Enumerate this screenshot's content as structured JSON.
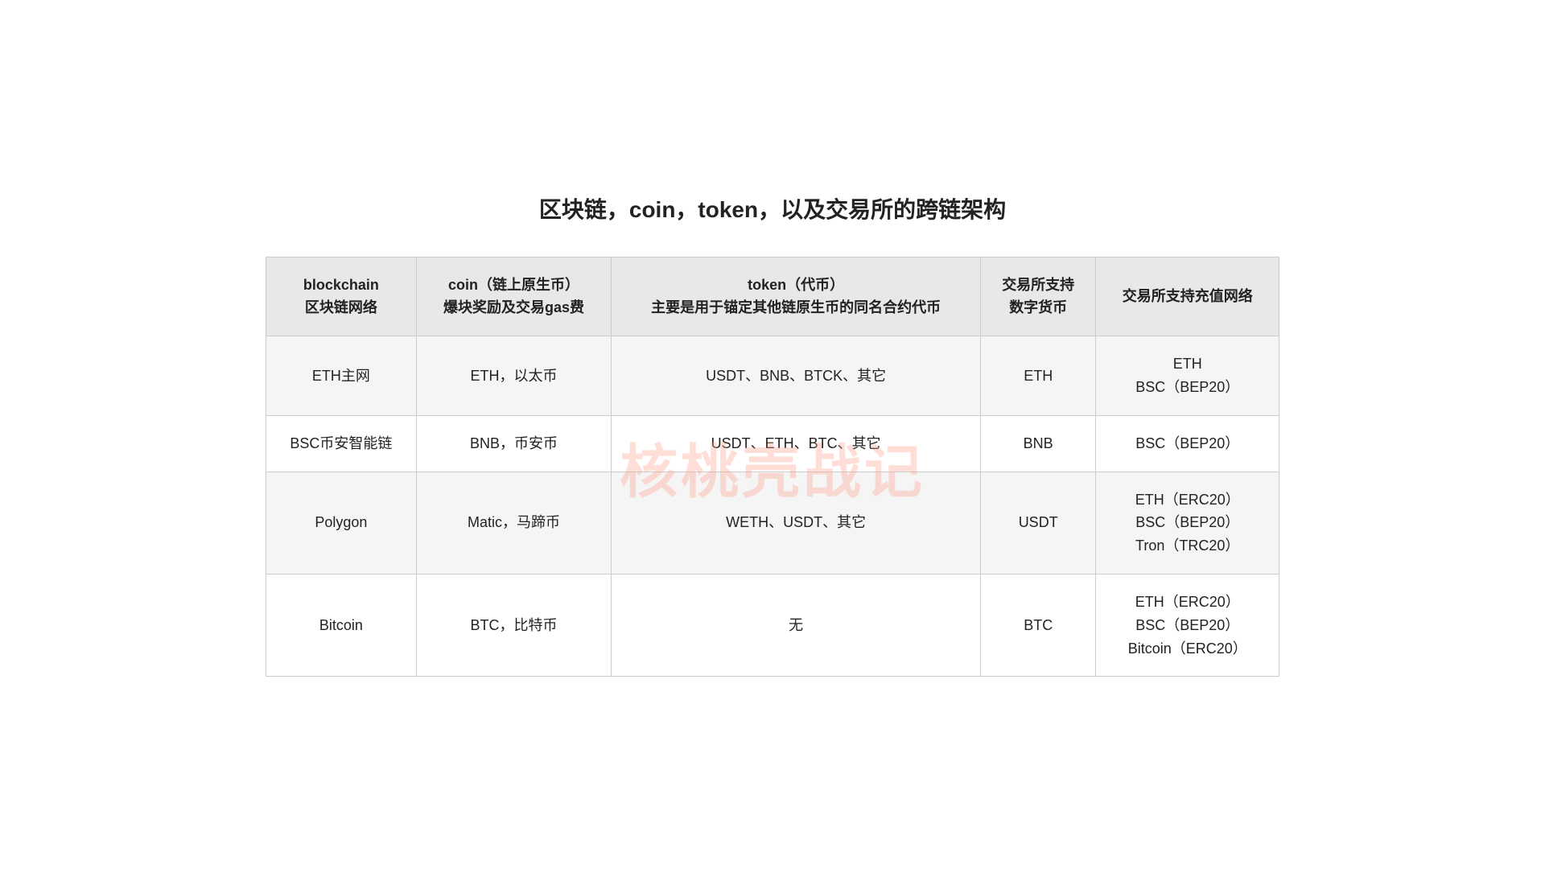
{
  "page": {
    "title": "区块链，coin，token，以及交易所的跨链架构"
  },
  "watermark": "核桃壳战记",
  "table": {
    "headers": [
      {
        "id": "col-blockchain",
        "line1": "blockchain",
        "line2": "区块链网络"
      },
      {
        "id": "col-coin",
        "line1": "coin（链上原生币）",
        "line2": "爆块奖励及交易gas费"
      },
      {
        "id": "col-token",
        "line1": "token（代币）",
        "line2": "主要是用于锚定其他链原生币的同名合约代币"
      },
      {
        "id": "col-exchange-coin",
        "line1": "交易所支持",
        "line2": "数字货币"
      },
      {
        "id": "col-exchange-network",
        "line1": "交易所支持充值网络",
        "line2": ""
      }
    ],
    "rows": [
      {
        "blockchain": "ETH主网",
        "coin": "ETH，以太币",
        "token": "USDT、BNB、BTCK、其它",
        "exchange_coin": "ETH",
        "exchange_network": "ETH\nBSC（BEP20）"
      },
      {
        "blockchain": "BSC币安智能链",
        "coin": "BNB，币安币",
        "token": "USDT、ETH、BTC、其它",
        "exchange_coin": "BNB",
        "exchange_network": "BSC（BEP20）"
      },
      {
        "blockchain": "Polygon",
        "coin": "Matic，马蹄币",
        "token": "WETH、USDT、其它",
        "exchange_coin": "USDT",
        "exchange_network": "ETH（ERC20）\nBSC（BEP20）\nTron（TRC20）"
      },
      {
        "blockchain": "Bitcoin",
        "coin": "BTC，比特币",
        "token": "无",
        "exchange_coin": "BTC",
        "exchange_network": "ETH（ERC20）\nBSC（BEP20）\nBitcoin（ERC20）"
      }
    ]
  }
}
